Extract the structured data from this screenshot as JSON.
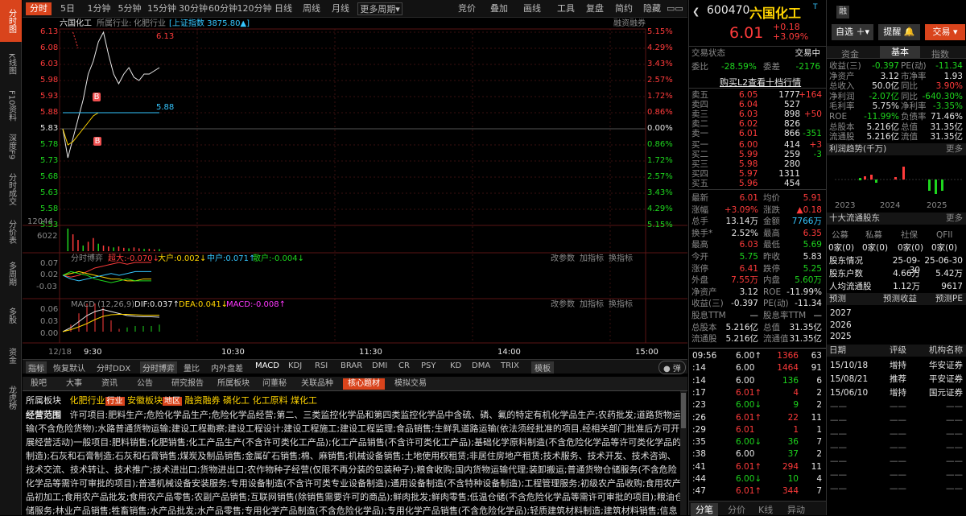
{
  "leftbar": [
    "分时图",
    "K线图",
    "F10资料",
    "深度F9",
    "分时成交",
    "分价表",
    "多周期",
    "多股",
    "资金",
    "龙虎榜"
  ],
  "topbar": {
    "periods": [
      "分时",
      "5日",
      "1分钟",
      "5分钟",
      "15分钟",
      "30分钟",
      "60分钟",
      "120分钟",
      "日线",
      "周线",
      "月线",
      "更多周期"
    ],
    "right": [
      "竞价",
      "叠加",
      "画线",
      "工具",
      "复盘",
      "简约",
      "隐藏"
    ],
    "more_arrow": "▾"
  },
  "chart": {
    "header": {
      "name": "六国化工",
      "industry_label": "所属行业:",
      "industry": "化肥行业",
      "index": "[上证指数 3875.80▲]",
      "margin": "融资融券"
    },
    "price_ticks": [
      "6.13",
      "6.08",
      "6.03",
      "5.98",
      "5.93",
      "5.88",
      "5.83",
      "5.78",
      "5.73",
      "5.68",
      "5.63",
      "5.58",
      "5.53"
    ],
    "pct_ticks": [
      "5.15%",
      "4.29%",
      "3.43%",
      "2.57%",
      "1.72%",
      "0.86%",
      "0.00%",
      "0.86%",
      "1.72%",
      "2.57%",
      "3.43%",
      "4.29%",
      "5.15%"
    ],
    "high_label": "6.13",
    "avg_label": "5.88",
    "marker": "B",
    "vol_ticks": [
      "12044",
      "6022"
    ],
    "flow": {
      "title": "分时博弈",
      "a": "超大:-0.070↓",
      "b": "大户:0.002↓",
      "c": "中户:0.071↑",
      "d": "散户:-0.004↓",
      "adj": "改参数",
      "add": "加指标",
      "swap": "换指标",
      "ticks": [
        "0.07",
        "0.02",
        "-0.03"
      ]
    },
    "macd": {
      "title": "MACD (12,26,9)",
      "dif": "DIF:0.037↑",
      "dea": "DEA:0.041↓",
      "macd": "MACD:-0.008↑",
      "adj": "改参数",
      "add": "加指标",
      "swap": "换指标",
      "ticks": [
        "0.06",
        "0.03",
        "0.00"
      ]
    },
    "times": [
      "12/18",
      "9:30",
      "10:30",
      "11:30",
      "14:00",
      "15:00"
    ],
    "price_series": [
      5.83,
      5.74,
      5.8,
      5.86,
      5.92,
      6.0,
      6.04,
      6.1,
      6.13,
      6.06,
      6.0,
      5.97,
      6.0,
      6.02,
      5.99,
      5.98,
      6.0,
      6.0,
      6.01,
      6.02
    ],
    "avg_series": [
      5.83,
      5.78,
      5.79,
      5.81,
      5.83,
      5.85,
      5.87,
      5.88,
      5.88,
      5.88,
      5.88,
      5.88,
      5.88,
      5.88,
      5.88,
      5.88,
      5.88,
      5.88,
      5.88,
      5.88
    ],
    "vol_series": [
      2,
      12044,
      9000,
      6000,
      3000,
      5000,
      7000,
      4000,
      3000,
      2500,
      2000,
      2500,
      1800,
      1500,
      2000,
      1500,
      1200,
      1300,
      900,
      1100
    ]
  },
  "bottomtabs": [
    "指标",
    "恢复默认",
    "分时DDX",
    "分时博弈",
    "量比",
    "内外盘差",
    "MACD",
    "KDJ",
    "RSI",
    "BRAR",
    "DMI",
    "CR",
    "PSY",
    "KD",
    "DMA",
    "TRIX",
    "模板",
    "弹"
  ],
  "infotabs": [
    "股吧",
    "大事",
    "资讯",
    "公告",
    "研究报告",
    "所属板块",
    "问董秘",
    "关联品种",
    "核心题材",
    "模拟交易"
  ],
  "info": {
    "sector_label": "所属板块",
    "sectors": [
      "化肥行业",
      "行业",
      "安徽板块",
      "地区",
      "融资融券",
      "磷化工",
      "化工原料",
      "煤化工"
    ],
    "scope_label": "经营范围",
    "scope": "许可项目:肥料生产;危险化学品生产;危险化学品经营;第二、三类监控化学品和第四类监控化学品中含硫、磷、氟的特定有机化学品生产;农药批发;道路货物运输(不含危险货物);水路普通货物运输;建设工程勘察;建设工程设计;建设工程施工;建设工程监理;食品销售;生鲜乳道路运输(依法须经批准的项目,经相关部门批准后方可开展经营活动)一般项目:肥料销售;化肥销售;化工产品生产(不含许可类化工产品);化工产品销售(不含许可类化工产品);基础化学原料制造(不含危险化学品等许可类化学品的制造);石灰和石膏制造;石灰和石膏销售;煤炭及制品销售;金属矿石销售;棉、麻销售;机械设备销售;土地使用权租赁;非居住房地产租赁;技术服务、技术开发、技术咨询、技术交流、技术转让、技术推广;技术进出口;货物进出口;农作物种子经营(仅限不再分装的包装种子);粮食收购;国内货物运输代理;装卸搬运;普通货物仓储服务(不含危险化学品等需许可审批的项目);普通机械设备安装服务;专用设备制造(不含许可类专业设备制造);通用设备制造(不含特种设备制造);工程管理服务;初级农产品收购;食用农产品初加工;食用农产品批发;食用农产品零售;农副产品销售;互联网销售(除销售需要许可的商品);鲜肉批发;鲜肉零售;低温仓储(不含危险化学品等需许可审批的项目);粮油仓储服务;林业产品销售;牲畜销售;水产品批发;水产品零售;专用化学产品制造(不含危险化学品);专用化学产品销售(不含危险化学品);轻质建筑材料制造;建筑材料销售;信息咨询服务(不含许可类信息咨询服务)"
  },
  "quote": {
    "code": "600470",
    "name": "六国化工",
    "badge": "T",
    "price": "6.01",
    "chg": "+0.18",
    "pct": "+3.09%",
    "tag": "融",
    "btns": [
      "自选",
      "提醒",
      "交易"
    ],
    "status_label": "交易状态",
    "status": "交易中",
    "wb_label": "委比",
    "wb": "-28.59%",
    "wc_label": "委差",
    "wc": "-2176",
    "l2": "购买L2查看十档行情",
    "asks": [
      [
        "卖五",
        "6.05",
        "1777",
        "+164"
      ],
      [
        "卖四",
        "6.04",
        "527",
        ""
      ],
      [
        "卖三",
        "6.03",
        "898",
        "+50"
      ],
      [
        "卖二",
        "6.02",
        "826",
        ""
      ],
      [
        "卖一",
        "6.01",
        "866",
        "-351"
      ]
    ],
    "bids": [
      [
        "买一",
        "6.00",
        "414",
        "+3"
      ],
      [
        "买二",
        "5.99",
        "259",
        "-3"
      ],
      [
        "买三",
        "5.98",
        "280",
        ""
      ],
      [
        "买四",
        "5.97",
        "1311",
        ""
      ],
      [
        "买五",
        "5.96",
        "454",
        ""
      ]
    ],
    "stats": [
      [
        "最新",
        "6.01",
        "均价",
        "5.91"
      ],
      [
        "涨幅",
        "+3.09%",
        "涨跌",
        "▲0.18"
      ],
      [
        "总手",
        "13.14万",
        "金额",
        "7766万"
      ],
      [
        "换手*",
        "2.52%",
        "最高",
        "6.35"
      ],
      [
        "最高",
        "6.03",
        "最低",
        "5.69"
      ],
      [
        "今开",
        "5.75",
        "昨收",
        "5.83"
      ],
      [
        "涨停",
        "6.41",
        "跌停",
        "5.25"
      ],
      [
        "外盘",
        "7.55万",
        "内盘",
        "5.60万"
      ],
      [
        "净资产",
        "3.12",
        "ROE",
        "-11.99%"
      ],
      [
        "收益(三)",
        "-0.397",
        "PE(动)",
        "-11.34"
      ],
      [
        "股息TTM",
        "—",
        "股息率TTM",
        "—"
      ],
      [
        "总股本",
        "5.216亿",
        "总值",
        "31.35亿"
      ],
      [
        "流通股",
        "5.216亿",
        "流通值",
        "31.35亿"
      ]
    ],
    "ticks": [
      [
        "09:56",
        "6.00↑",
        "1366",
        "63"
      ],
      [
        ":14",
        "6.00",
        "1464",
        "91"
      ],
      [
        ":14",
        "6.00",
        "136",
        "6"
      ],
      [
        ":17",
        "6.01↑",
        "4",
        "2"
      ],
      [
        ":23",
        "6.00↓",
        "9",
        "2"
      ],
      [
        ":26",
        "6.01↑",
        "22",
        "11"
      ],
      [
        ":29",
        "6.01",
        "1",
        "1"
      ],
      [
        ":35",
        "6.00↓",
        "36",
        "7"
      ],
      [
        ":38",
        "6.00",
        "37",
        "2"
      ],
      [
        ":41",
        "6.01↑",
        "294",
        "11"
      ],
      [
        ":44",
        "6.00↓",
        "10",
        "4"
      ],
      [
        ":47",
        "6.01↑",
        "344",
        "7"
      ]
    ],
    "bottom_tabs": [
      "分笔",
      "分价",
      "K线",
      "异动"
    ]
  },
  "fund": {
    "tabs": [
      "资金",
      "基本",
      "指数"
    ],
    "basics": [
      [
        "收益(三)",
        "-0.397",
        "PE(动)",
        "-11.34"
      ],
      [
        "净资产",
        "3.12",
        "市净率",
        "1.93"
      ],
      [
        "总收入",
        "50.0亿",
        "同比",
        "3.90%"
      ],
      [
        "净利润",
        "-2.07亿",
        "同比",
        "-640.30%"
      ],
      [
        "毛利率",
        "5.75%",
        "净利率",
        "-3.35%"
      ],
      [
        "ROE",
        "-11.99%",
        "负债率",
        "71.46%"
      ],
      [
        "总股本",
        "5.216亿",
        "总值",
        "31.35亿"
      ],
      [
        "流通股",
        "5.216亿",
        "流值",
        "31.35亿"
      ]
    ],
    "profit_title": "利润趋势(千万)",
    "more": "更多",
    "years": [
      "2023",
      "2024",
      "2025"
    ],
    "holders_title": "十大流通股东",
    "holder_types": [
      "公募",
      "私募",
      "社保",
      "QFII"
    ],
    "holder_counts": [
      "0家(0)",
      "0家(0)",
      "0家(0)",
      "0家(0)"
    ],
    "holder_stats": [
      [
        "股东情况",
        "25-09-30",
        "25-06-30"
      ],
      [
        "股东户数",
        "4.66万",
        "5.42万"
      ],
      [
        "人均流通股",
        "1.12万",
        "9617"
      ]
    ],
    "forecast": [
      "预测",
      "预测收益",
      "预测PE"
    ],
    "forecast_years": [
      "2027",
      "2026",
      "2025"
    ],
    "rating_head": [
      "日期",
      "评级",
      "机构名称"
    ],
    "ratings": [
      [
        "15/10/18",
        "增持",
        "华安证券"
      ],
      [
        "15/08/21",
        "推荐",
        "平安证券"
      ],
      [
        "15/06/10",
        "增持",
        "国元证券"
      ]
    ],
    "blank": "——"
  }
}
